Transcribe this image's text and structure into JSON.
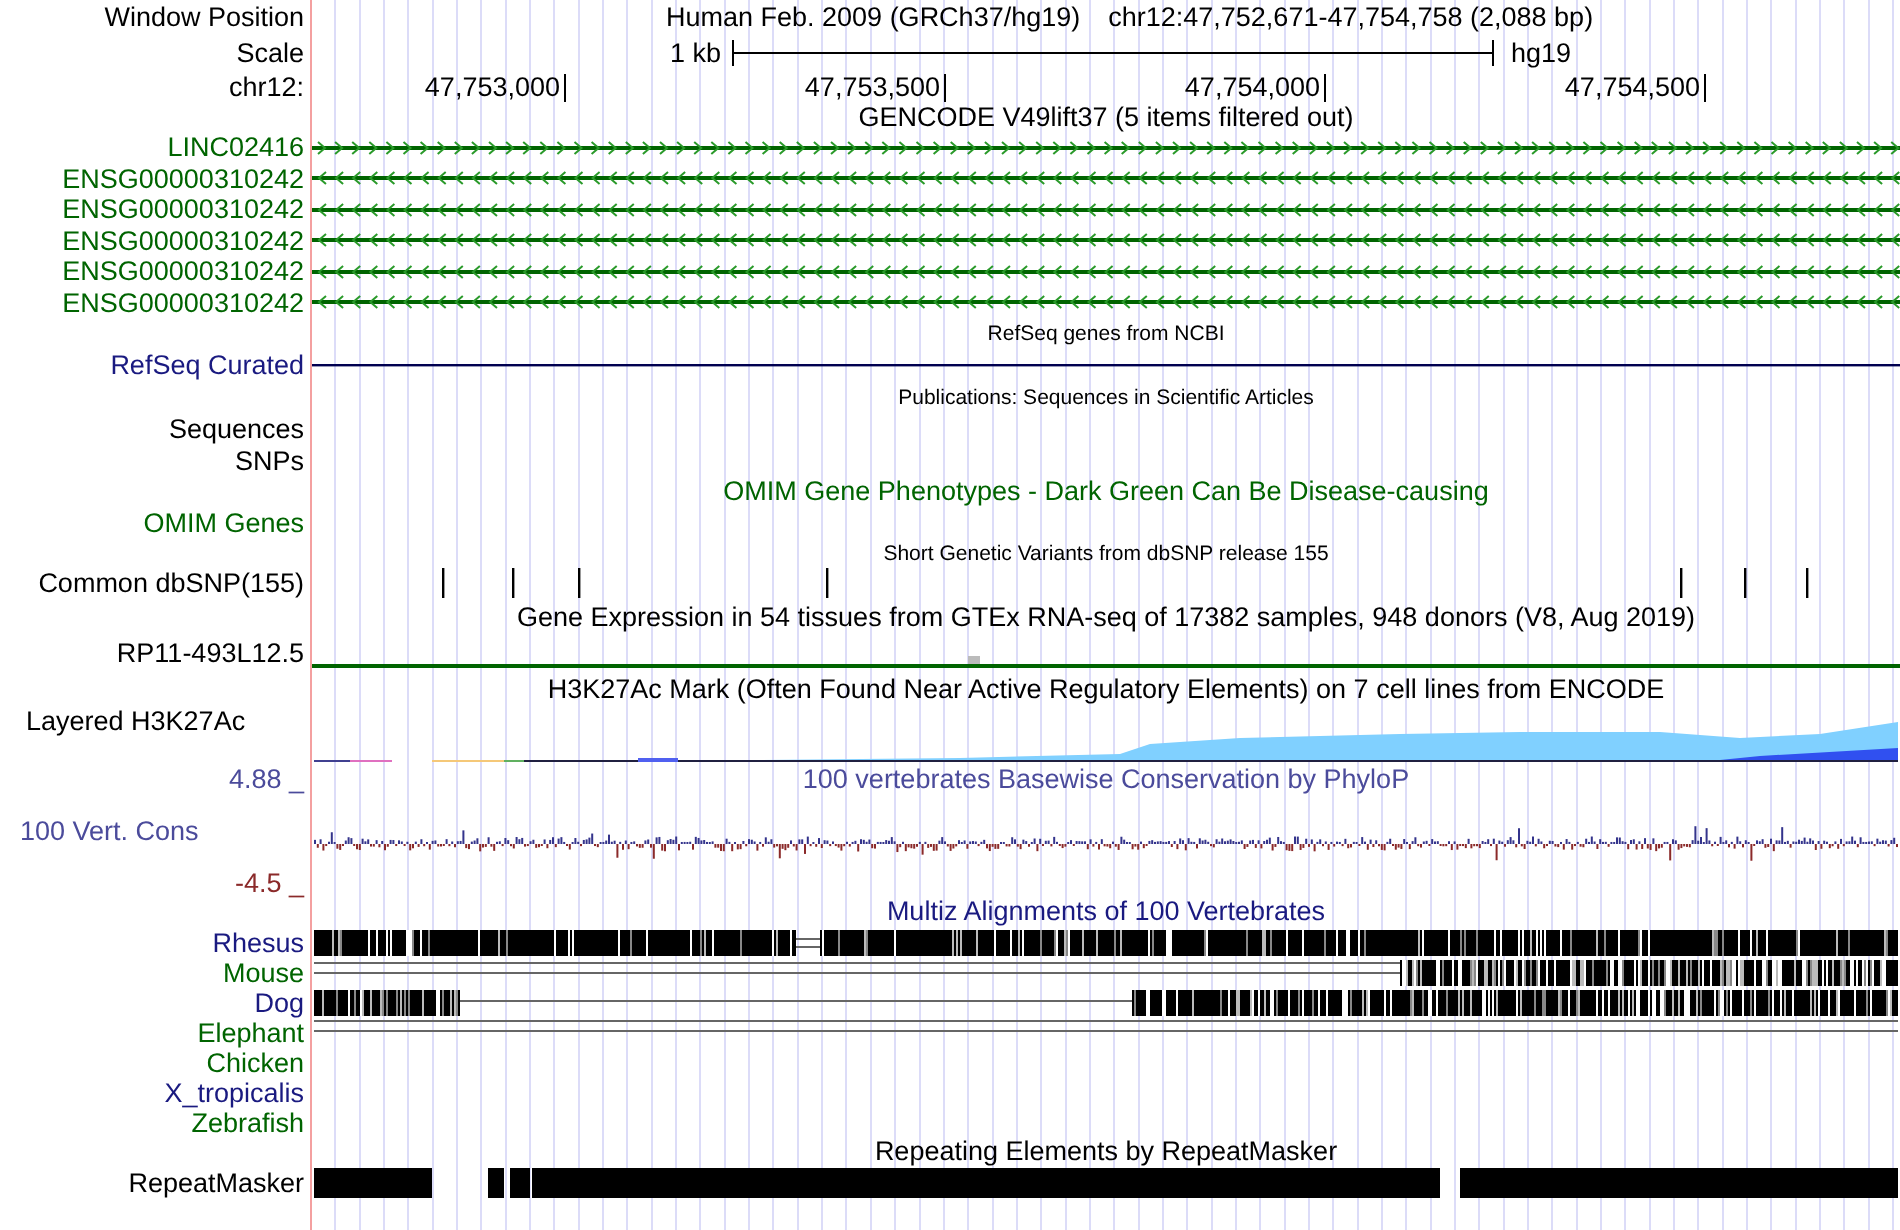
{
  "header": {
    "label": "Window Position",
    "assembly": "Human Feb. 2009 (GRCh37/hg19)",
    "position": "chr12:47,752,671-47,754,758 (2,088 bp)"
  },
  "scale": {
    "label": "Scale",
    "length": "1 kb",
    "assembly": "hg19"
  },
  "ruler": {
    "label": "chr12:",
    "ticks": [
      "47,753,000",
      "47,753,500",
      "47,754,000",
      "47,754,500"
    ]
  },
  "tracks": [
    {
      "kind": "genes",
      "title": "GENCODE V49lift37 (5 items filtered out)",
      "items": [
        {
          "name": "LINC02416",
          "reverse": false
        },
        {
          "name": "ENSG00000310242",
          "reverse": true
        },
        {
          "name": "ENSG00000310242",
          "reverse": true
        },
        {
          "name": "ENSG00000310242",
          "reverse": true
        },
        {
          "name": "ENSG00000310242",
          "reverse": true
        },
        {
          "name": "ENSG00000310242",
          "reverse": true
        }
      ]
    },
    {
      "kind": "refseq",
      "title": "RefSeq genes from NCBI",
      "label": "RefSeq Curated"
    },
    {
      "kind": "publications",
      "title": "Publications: Sequences in Scientific Articles",
      "labels": [
        "Sequences",
        "SNPs"
      ]
    },
    {
      "kind": "omim",
      "title": "OMIM Gene Phenotypes - Dark Green Can Be Disease-causing",
      "label": "OMIM Genes"
    },
    {
      "kind": "snps",
      "title": "Short Genetic Variants from dbSNP release 155",
      "label": "Common dbSNP(155)"
    },
    {
      "kind": "expression",
      "title": "Gene Expression in 54 tissues from GTEx RNA-seq of 17382 samples, 948 donors (V8, Aug 2019)",
      "label": "RP11-493L12.5"
    },
    {
      "kind": "layered",
      "title": "H3K27Ac Mark (Often Found Near Active Regulatory Elements) on 7 cell lines from ENCODE",
      "label": "Layered H3K27Ac"
    },
    {
      "kind": "wiggle",
      "title": "100 vertebrates Basewise Conservation by PhyloP",
      "label": "100 Vert. Cons",
      "max": "4.88 _",
      "min": "-4.5 _"
    },
    {
      "kind": "multiz",
      "title": "Multiz Alignments of 100 Vertebrates",
      "species": [
        {
          "name": "Rhesus",
          "color": "#1a1a80",
          "kind": "gapped"
        },
        {
          "name": "Mouse",
          "color": "#006400",
          "kind": "right"
        },
        {
          "name": "Dog",
          "color": "#1a1a80",
          "kind": "split"
        },
        {
          "name": "Elephant",
          "color": "#006400",
          "kind": "lines"
        },
        {
          "name": "Chicken",
          "color": "#006400",
          "kind": "none"
        },
        {
          "name": "X_tropicalis",
          "color": "#1a1a80",
          "kind": "none"
        },
        {
          "name": "Zebrafish",
          "color": "#006400",
          "kind": "none"
        }
      ]
    },
    {
      "kind": "repeats",
      "title": "Repeating Elements by RepeatMasker",
      "label": "RepeatMasker"
    }
  ]
}
